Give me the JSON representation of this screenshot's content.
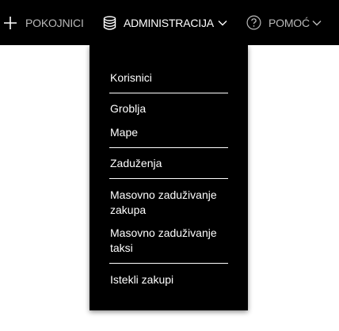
{
  "nav": {
    "items": [
      {
        "label": "POKOJNICI",
        "icon": "plus-icon"
      },
      {
        "label": "ADMINISTRACIJA",
        "icon": "database-icon"
      },
      {
        "label": "POMOĆ",
        "icon": "help-circle-icon"
      }
    ],
    "active_color": "#ffffff",
    "inactive_color": "#b9b9b9",
    "background": "#000000"
  },
  "dropdown": {
    "items": [
      "Korisnici",
      "Groblja",
      "Mape",
      "Zaduženja",
      "Masovno zaduživanje zakupa",
      "Masovno zaduživanje taksi",
      "Istekli zakupi"
    ]
  }
}
